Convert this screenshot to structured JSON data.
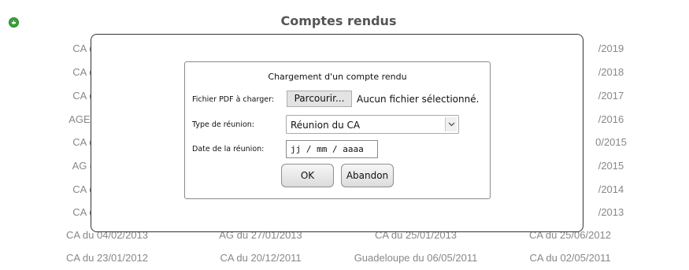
{
  "page": {
    "title": "Comptes rendus",
    "add_icon": "plus-circle-icon",
    "reports": [
      "CA du",
      "/2019",
      "CA du",
      "/2018",
      "CA du",
      "/2017",
      "AGE du",
      "/2016",
      "CA du",
      "0/2015",
      "AG du",
      "/2015",
      "CA du",
      "/2014",
      "CA du",
      "/2013",
      "CA du 04/02/2013",
      "AG du 27/01/2013",
      "CA du 25/01/2013",
      "CA du 25/06/2012",
      "CA du 23/01/2012",
      "CA du 20/12/2011",
      "Guadeloupe du 06/05/2011",
      "CA du 02/05/2011"
    ]
  },
  "dialog": {
    "title": "Chargement d'un compte rendu",
    "file_label": "Fichier PDF à charger:",
    "browse_label": "Parcourir...",
    "file_status": "Aucun fichier sélectionné.",
    "meeting_type_label": "Type de réunion:",
    "meeting_type_value": "Réunion du CA",
    "date_label": "Date de la réunion:",
    "date_placeholder": "jj / mm / aaaa",
    "ok_label": "OK",
    "cancel_label": "Abandon",
    "select_arrow_icon": "chevron-down-icon"
  }
}
